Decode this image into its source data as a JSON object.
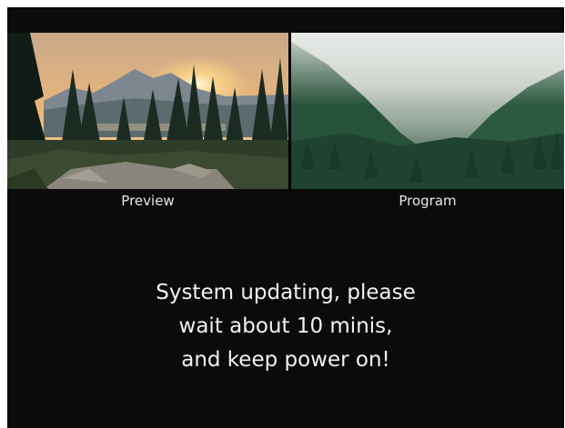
{
  "monitors": {
    "preview": {
      "label": "Preview",
      "scene": "mountain-sunset-forest"
    },
    "program": {
      "label": "Program",
      "scene": "misty-forest-valley"
    }
  },
  "status": {
    "message_lines": [
      "System updating, please",
      "wait about 10 minis,",
      "and keep power on!"
    ]
  },
  "colors": {
    "screen_background": "#0b0b0b",
    "text": "#f2f2f2"
  }
}
